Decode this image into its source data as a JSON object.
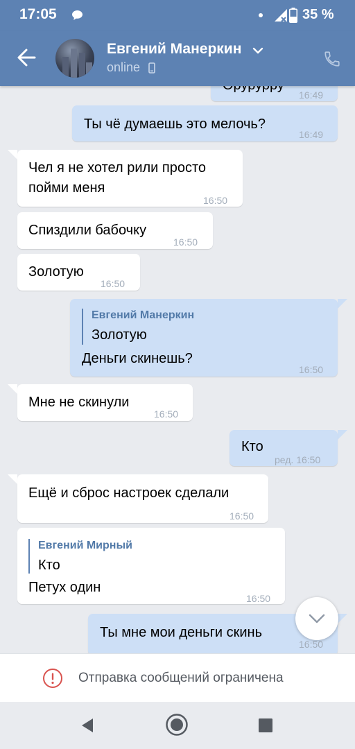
{
  "status_bar": {
    "time": "17:05",
    "battery": "35 %"
  },
  "header": {
    "name": "Евгений Манеркин",
    "status": "online"
  },
  "messages": [
    {
      "text": "Орурурру",
      "time": "16:49"
    },
    {
      "text": "Ты чё думаешь это мелочь?",
      "time": "16:49"
    },
    {
      "line1": "Чел я не хотел рили просто",
      "line2": "пойми меня",
      "time": "16:50"
    },
    {
      "text": "Спиздили бабочку",
      "time": "16:50"
    },
    {
      "text": "Золотую",
      "time": "16:50"
    },
    {
      "reply_name": "Евгений Манеркин",
      "reply_text": "Золотую",
      "text": "Деньги скинешь?",
      "time": "16:50"
    },
    {
      "text": "Мне не скинули",
      "time": "16:50"
    },
    {
      "text": "Кто",
      "time": "ред. 16:50"
    },
    {
      "text": "Ещё и сброс настроек сделали",
      "time": "16:50"
    },
    {
      "reply_name": "Евгений Мирный",
      "reply_text": "Кто",
      "text": "Петух один",
      "time": "16:50"
    },
    {
      "text": "Ты мне мои деньги скинь",
      "time": "16:50"
    }
  ],
  "restriction": {
    "text": "Отправка сообщений ограничена"
  }
}
